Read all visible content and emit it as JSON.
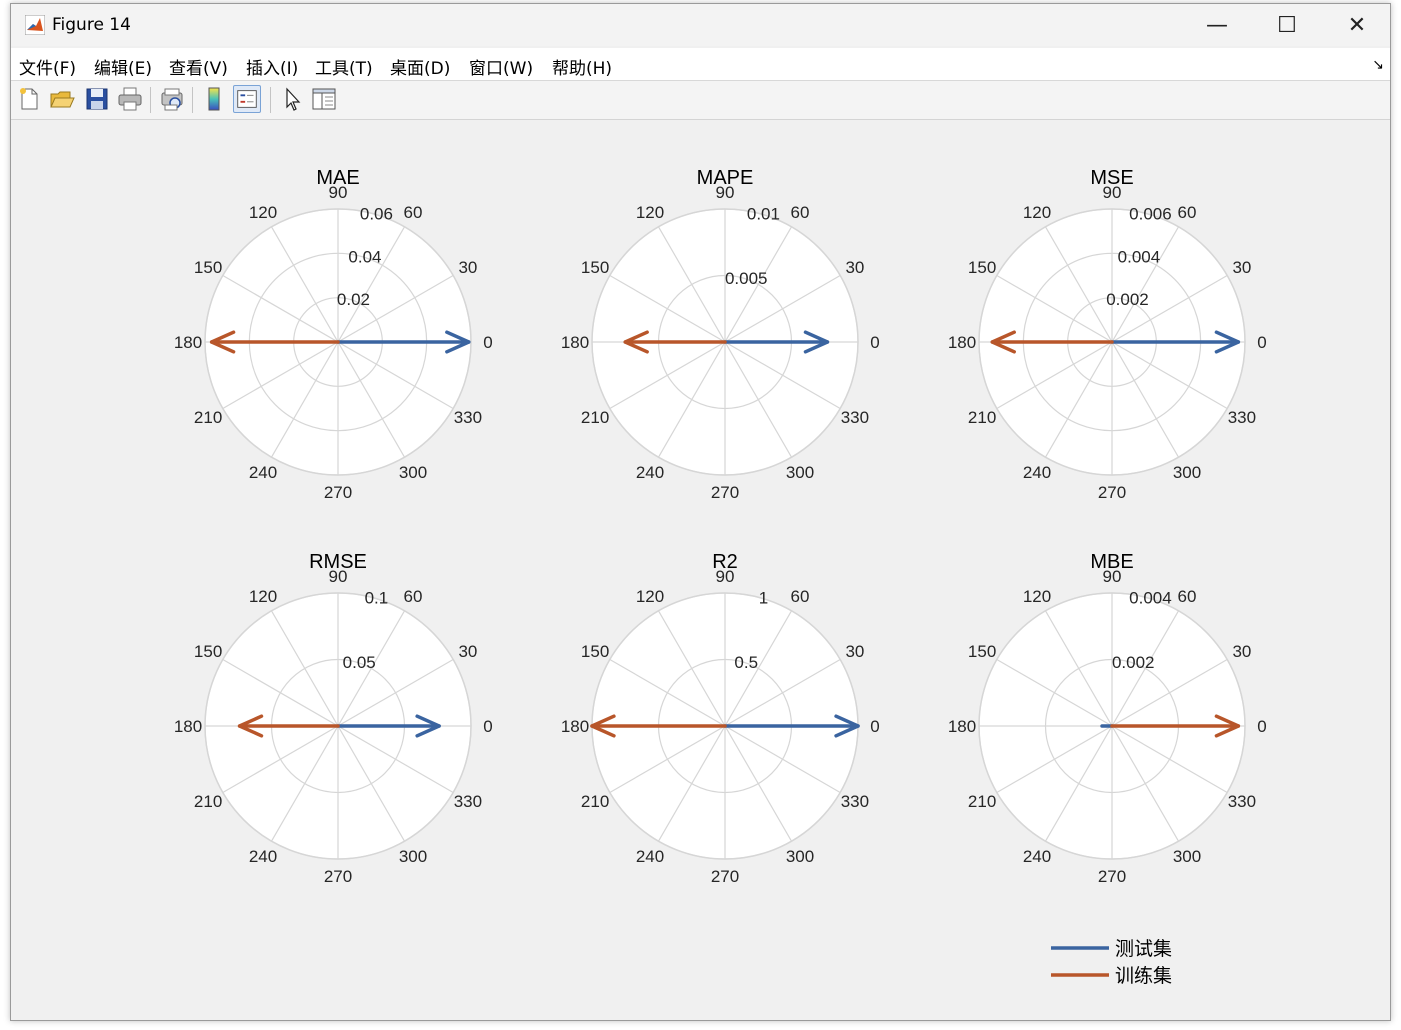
{
  "window": {
    "title": "Figure 14",
    "minimize": "—",
    "maximize": "☐",
    "close": "✕"
  },
  "menu": [
    "文件(F)",
    "编辑(E)",
    "查看(V)",
    "插入(I)",
    "工具(T)",
    "桌面(D)",
    "窗口(W)",
    "帮助(H)"
  ],
  "toolbar_icons": [
    "new-figure-icon",
    "open-file-icon",
    "save-icon",
    "print-icon",
    "print-preview-icon",
    "colorbar-icon",
    "legend-icon",
    "pointer-icon",
    "property-editor-icon"
  ],
  "colors": {
    "test": "#3a64a0",
    "train": "#b8562a",
    "grid": "#d6d6d6"
  },
  "angle_labels": [
    "0",
    "30",
    "60",
    "90",
    "120",
    "150",
    "180",
    "210",
    "240",
    "270",
    "300",
    "330"
  ],
  "legend": {
    "test": "测试集",
    "train": "训练集"
  },
  "chart_data": [
    {
      "type": "polar",
      "title": "MAE",
      "rlim": [
        0,
        0.06
      ],
      "rticks": [
        "0.02",
        "0.04",
        "0.06"
      ],
      "series": [
        {
          "name": "测试集",
          "angle": 0,
          "r": 0.059
        },
        {
          "name": "训练集",
          "angle": 180,
          "r": 0.057
        }
      ]
    },
    {
      "type": "polar",
      "title": "MAPE",
      "rlim": [
        0,
        0.01
      ],
      "rticks": [
        "0.005",
        "0.01"
      ],
      "series": [
        {
          "name": "测试集",
          "angle": 0,
          "r": 0.0077
        },
        {
          "name": "训练集",
          "angle": 180,
          "r": 0.0075
        }
      ]
    },
    {
      "type": "polar",
      "title": "MSE",
      "rlim": [
        0,
        0.006
      ],
      "rticks": [
        "0.002",
        "0.004",
        "0.006"
      ],
      "series": [
        {
          "name": "测试集",
          "angle": 0,
          "r": 0.0057
        },
        {
          "name": "训练集",
          "angle": 180,
          "r": 0.0054
        }
      ]
    },
    {
      "type": "polar",
      "title": "RMSE",
      "rlim": [
        0,
        0.1
      ],
      "rticks": [
        "0.05",
        "0.1"
      ],
      "series": [
        {
          "name": "测试集",
          "angle": 0,
          "r": 0.076
        },
        {
          "name": "训练集",
          "angle": 180,
          "r": 0.074
        }
      ]
    },
    {
      "type": "polar",
      "title": "R2",
      "rlim": [
        0,
        1
      ],
      "rticks": [
        "0.5",
        "1"
      ],
      "series": [
        {
          "name": "测试集",
          "angle": 0,
          "r": 1.0
        },
        {
          "name": "训练集",
          "angle": 180,
          "r": 1.0
        }
      ]
    },
    {
      "type": "polar",
      "title": "MBE",
      "rlim": [
        0,
        0.004
      ],
      "rticks": [
        "0.002",
        "0.004"
      ],
      "series": [
        {
          "name": "测试集",
          "angle": 180,
          "r": 0.0003
        },
        {
          "name": "训练集",
          "angle": 0,
          "r": 0.0038
        }
      ]
    }
  ]
}
